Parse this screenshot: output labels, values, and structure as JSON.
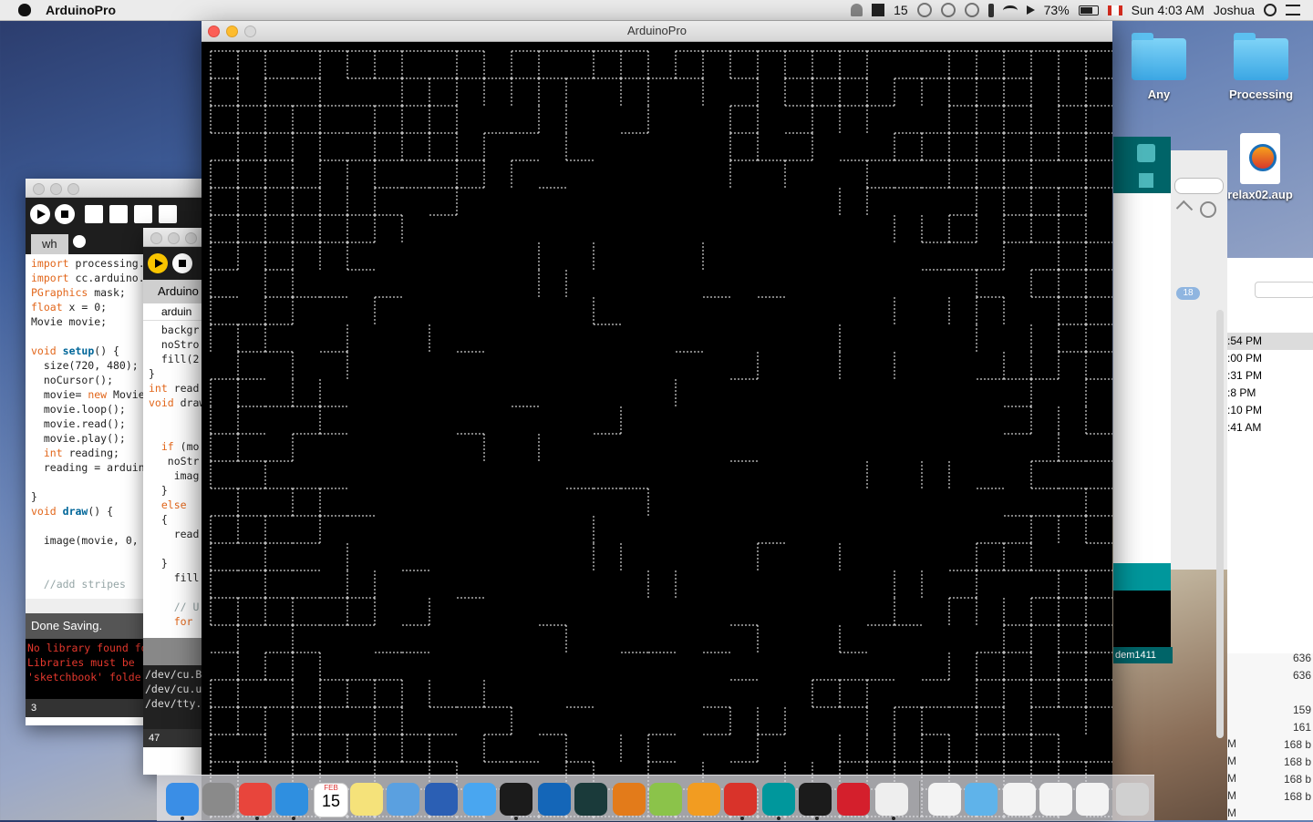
{
  "menubar": {
    "app_name": "ArduinoPro",
    "notif_count": "15",
    "battery": "73%",
    "clock": "Sun 4:03 AM",
    "user": "Joshua"
  },
  "desktop": {
    "icons": [
      "Any",
      "Processing",
      "relax02.aup"
    ]
  },
  "main_window": {
    "title": "ArduinoPro"
  },
  "sketch_left": {
    "tab": "wh",
    "code_lines": [
      "import processing.",
      "import cc.arduino.",
      "PGraphics mask;",
      "float x = 0;",
      "Movie movie;",
      "",
      "void setup() {",
      "  size(720, 480);",
      "  noCursor();",
      "  movie= new Movie",
      "  movie.loop();",
      "  movie.read();",
      "  movie.play();",
      "  int reading;",
      "  reading = arduin",
      "",
      "}",
      "void draw() {",
      "",
      "  image(movie, 0,",
      "",
      "",
      "  //add stripes"
    ],
    "status": "Done Saving.",
    "console_lines": [
      "No library found fo",
      "Libraries must be",
      "'sketchbook' folde"
    ],
    "line_number": "3"
  },
  "sketch_mid": {
    "tab": "Arduino",
    "subtab": "arduin",
    "code_lines": [
      "  backgr",
      "  noStro",
      "  fill(2",
      "}",
      "int read",
      "void draw",
      "",
      "",
      "  if (mo",
      "   noStr",
      "    imag",
      "  }",
      "  else",
      "  {",
      "    read",
      "",
      "  }",
      "    fill",
      "",
      "    // U",
      "    for"
    ],
    "console_lines": [
      "/dev/cu.B",
      "/dev/cu.u",
      "/dev/tty."
    ],
    "line_number": "47"
  },
  "right_windows": {
    "serial_port": "dem1411",
    "badge": "18",
    "times": [
      ":54 PM",
      ":00 PM",
      ":31 PM",
      ":8 PM",
      ":10 PM",
      ":41 AM"
    ],
    "sizes": [
      "636",
      "636",
      "159",
      "161",
      "168 b",
      "168 b",
      "168 b",
      "168 b",
      "168 b"
    ],
    "size_prefix": "M"
  },
  "dock": {
    "icons": [
      "finder-icon",
      "system-preferences-icon",
      "chrome-icon",
      "safari-icon",
      "calendar-icon",
      "notes-icon",
      "preview-icon",
      "word-icon",
      "messages-icon",
      "processing-icon",
      "quicktime-icon",
      "audition-icon",
      "audacity-icon",
      "android-icon",
      "ibooks-icon",
      "acrobat-icon",
      "arduino-icon",
      "processing2-icon",
      "flipboard-icon",
      "java-icon",
      "documents-icon",
      "downloads-icon",
      "file1-icon",
      "file2-icon",
      "file3-icon",
      "trash-icon"
    ],
    "calendar_month": "FEB",
    "calendar_day": "15"
  },
  "colors": {
    "arduino_teal": "#00979c",
    "processing_dark": "#1e1e1e",
    "console_red": "#e5382d"
  }
}
